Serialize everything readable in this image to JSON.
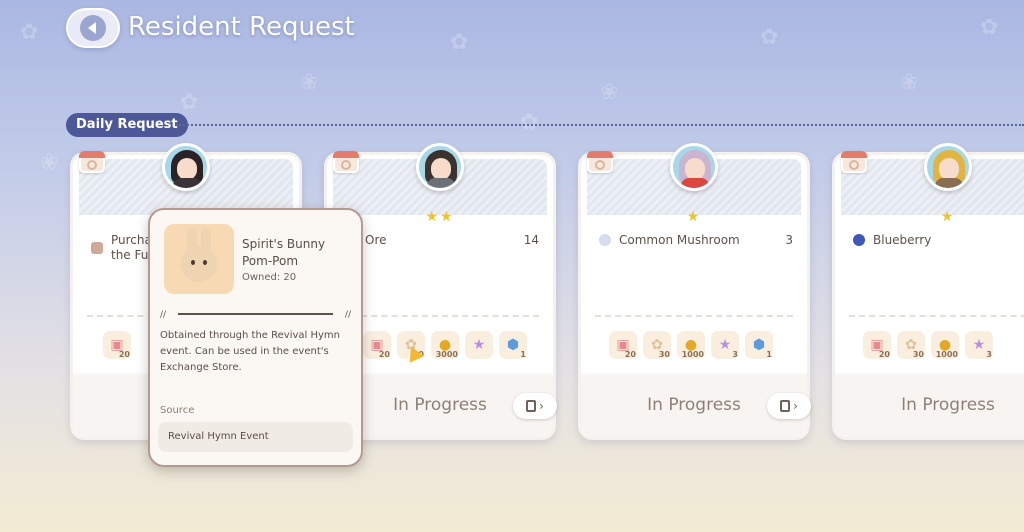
{
  "header": {
    "title": "Resident Request"
  },
  "section": {
    "label": "Daily Request"
  },
  "cards": [
    {
      "request": {
        "name": "Purchase ... the Fu...",
        "qty": ""
      },
      "stars": "",
      "rewards": [
        "20",
        "",
        "",
        "",
        ""
      ],
      "status": ""
    },
    {
      "request": {
        "name": "Ore",
        "qty": "14"
      },
      "stars": "★★",
      "rewards": [
        "20",
        "30",
        "3000",
        "",
        "1"
      ],
      "status": "In Progress"
    },
    {
      "request": {
        "name": "Common Mushroom",
        "qty": "3"
      },
      "stars": "★",
      "rewards": [
        "20",
        "30",
        "1000",
        "3",
        "1"
      ],
      "status": "In Progress"
    },
    {
      "request": {
        "name": "Blueberry",
        "qty": ""
      },
      "stars": "★",
      "rewards": [
        "20",
        "30",
        "1000",
        "3",
        ""
      ],
      "status": "In Progress"
    }
  ],
  "card1_partial": {
    "line1": "Purcha",
    "line2": "the Fu"
  },
  "tooltip": {
    "name": "Spirit's Bunny Pom-Pom",
    "owned": "Owned: 20",
    "description": "Obtained through the Revival Hymn event. Can be used in the event's Exchange Store.",
    "source_label": "Source",
    "source_value": "Revival Hymn Event"
  },
  "colors": {
    "accent": "#4d5899",
    "star": "#f2c22b",
    "status_text": "#8d8177"
  }
}
